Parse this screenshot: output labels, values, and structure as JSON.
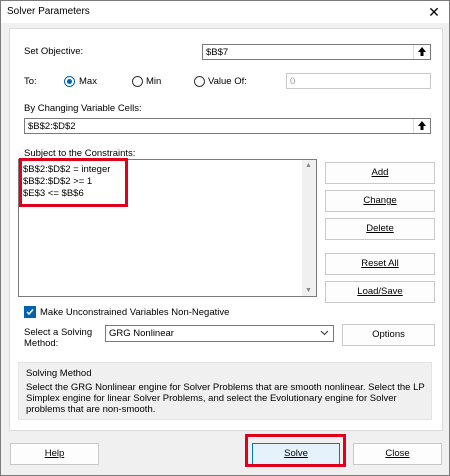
{
  "window": {
    "title": "Solver Parameters"
  },
  "objective": {
    "label": "Set Objective:",
    "value": "$B$7"
  },
  "to": {
    "label": "To:",
    "options": [
      "Max",
      "Min",
      "Value Of:"
    ],
    "selected": "Max",
    "value_of": "0"
  },
  "changing": {
    "label": "By Changing Variable Cells:",
    "value": "$B$2:$D$2"
  },
  "constraints": {
    "label": "Subject to the Constraints:",
    "items": [
      "$B$2:$D$2 = integer",
      "$B$2:$D$2 >= 1",
      "$E$3 <= $B$6"
    ]
  },
  "side_buttons": {
    "add": "Add",
    "change": "Change",
    "delete": "Delete",
    "reset_all": "Reset All",
    "load_save": "Load/Save"
  },
  "nonneg": {
    "label": "Make Unconstrained Variables Non-Negative",
    "checked": true
  },
  "method": {
    "label_line1": "Select a Solving",
    "label_line2": "Method:",
    "value": "GRG Nonlinear",
    "options_button": "Options"
  },
  "solving_method": {
    "title": "Solving Method",
    "text": "Select the GRG Nonlinear engine for Solver Problems that are smooth nonlinear. Select the LP Simplex engine for linear Solver Problems, and select the Evolutionary engine for Solver problems that are non-smooth."
  },
  "footer": {
    "help": "Help",
    "solve": "Solve",
    "close": "Close"
  },
  "colors": {
    "accent": "#0063b1",
    "highlight": "#e0001b"
  }
}
